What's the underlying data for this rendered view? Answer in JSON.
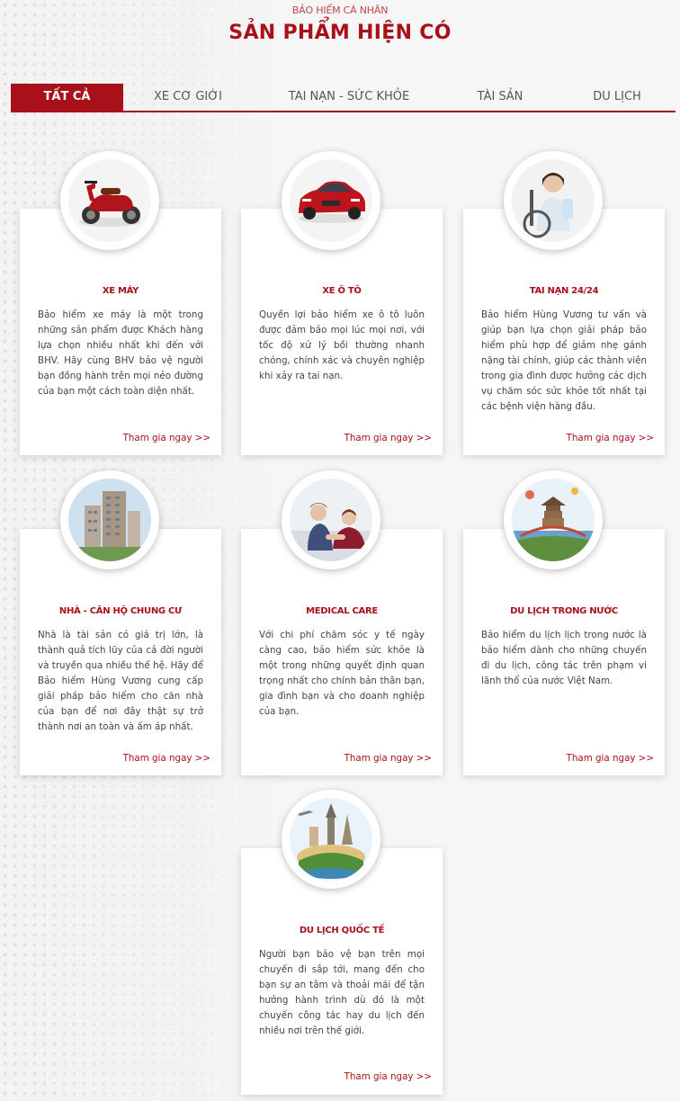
{
  "header": {
    "subtitle": "BẢO HIỂM CÁ NHÂN",
    "title": "SẢN PHẨM HIỆN CÓ"
  },
  "tabs": [
    {
      "label": "TẤT CẢ",
      "active": true
    },
    {
      "label": "XE CƠ GIỚI",
      "active": false
    },
    {
      "label": "TAI NẠN - SỨC KHỎE",
      "active": false
    },
    {
      "label": "TÀI SẢN",
      "active": false
    },
    {
      "label": "DU LỊCH",
      "active": false
    }
  ],
  "cards": [
    {
      "name": "XE MÁY",
      "icon": "motorbike-image",
      "desc": "Bảo hiểm xe máy là một trong những sản phẩm được Khách hàng lựa chọn nhiều nhất khi đến với BHV. Hãy cùng BHV bảo vệ người bạn đồng hành trên mọi nẻo đường của bạn một cách toàn diện nhất.",
      "link": "Tham gia ngay >>"
    },
    {
      "name": "XE Ô TÔ",
      "icon": "car-image",
      "desc": "Quyền lợi bảo hiểm xe ô tô luôn được đảm bảo mọi lúc mọi nơi, với tốc độ xử lý bồi thường nhanh chóng, chính xác và chuyên nghiệp khi xảy ra tai nạn.",
      "link": "Tham gia ngay >>"
    },
    {
      "name": "TAI NẠN 24/24",
      "icon": "injured-person-image",
      "desc": "Bảo hiểm Hùng Vương tư vấn và giúp bạn lựa chọn giải pháp bảo hiểm phù hợp để giảm nhẹ gánh nặng tài chính, giúp các thành viên trong gia đình được hưởng các dịch vụ chăm sóc sức khỏe tốt nhất tại các bệnh viện hàng đầu.",
      "link": "Tham gia ngay >>"
    },
    {
      "name": "NHÀ - CĂN HỘ CHUNG CƯ",
      "icon": "apartment-image",
      "desc": "Nhà là tài sản có giá trị lớn, là thành quả tích lũy của cả đời người và truyền qua nhiều thế hệ. Hãy để Bảo hiểm Hùng Vương cung cấp giải pháp bảo hiểm cho căn nhà của bạn để nơi đây thật sự trở thành nơi an toàn và ấm áp nhất.",
      "link": "Tham gia ngay >>"
    },
    {
      "name": "MEDICAL CARE",
      "icon": "medical-care-image",
      "desc": "Với chi phí chăm sóc y tế ngày càng cao, bảo hiểm sức khỏe là một trong những quyết định quan trọng nhất cho chính bản thân bạn, gia đình bạn và cho doanh nghiệp của bạn.",
      "link": "Tham gia ngay >>"
    },
    {
      "name": "DU LỊCH TRONG NƯỚC",
      "icon": "domestic-travel-image",
      "desc": "Bảo hiểm du lịch lịch trong nước là bảo hiểm dành cho những chuyến đi du lịch, công tác trên phạm vi lãnh thổ của nước Việt Nam.",
      "link": "Tham gia ngay >>"
    },
    {
      "name": "DU LỊCH QUỐC TẾ",
      "icon": "international-travel-image",
      "desc": "Người bạn bảo vệ bạn trên mọi chuyến đi sắp tới, mang đến cho bạn sự an tâm và thoải mái để tận hưởng hành trình dù đó là một chuyến công tác hay du lịch đến nhiều nơi trên thế giới.",
      "link": "Tham gia ngay >>"
    }
  ],
  "colors": {
    "brand": "#a8111a",
    "background": "#f3f3f3"
  }
}
